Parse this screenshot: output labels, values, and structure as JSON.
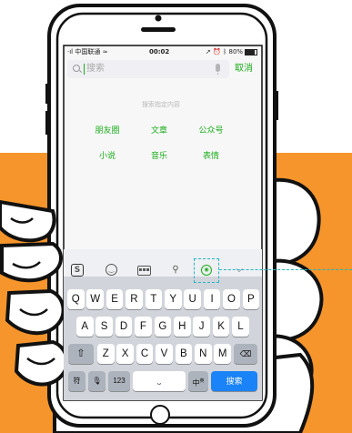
{
  "status_bar": {
    "carrier": "中国联通",
    "time": "00:02",
    "battery": "80%"
  },
  "search": {
    "placeholder": "搜索",
    "cancel_label": "取消"
  },
  "hint": "搜索指定内容",
  "categories": [
    {
      "label": "朋友圈"
    },
    {
      "label": "文章"
    },
    {
      "label": "公众号"
    },
    {
      "label": "小说"
    },
    {
      "label": "音乐"
    },
    {
      "label": "表情"
    }
  ],
  "keyboard": {
    "toolbar_icons": [
      "sogou-logo-icon",
      "emoji-icon",
      "keyboard-icon",
      "search-icon",
      "sticker-icon",
      "collapse-icon"
    ],
    "row1": [
      "Q",
      "W",
      "E",
      "R",
      "T",
      "Y",
      "U",
      "I",
      "O",
      "P"
    ],
    "row2": [
      "A",
      "S",
      "D",
      "F",
      "G",
      "H",
      "J",
      "K",
      "L"
    ],
    "row3": [
      "Z",
      "X",
      "C",
      "V",
      "B",
      "N",
      "M"
    ],
    "symbol_label": "符",
    "num_label": "123",
    "lang_label": "中",
    "lang_sub": "英",
    "send_label": "搜索"
  },
  "colors": {
    "orange": "#f5952b",
    "accent_green": "#1aad19",
    "send_blue": "#1a83f7",
    "highlight_cyan": "#22b8c8"
  }
}
